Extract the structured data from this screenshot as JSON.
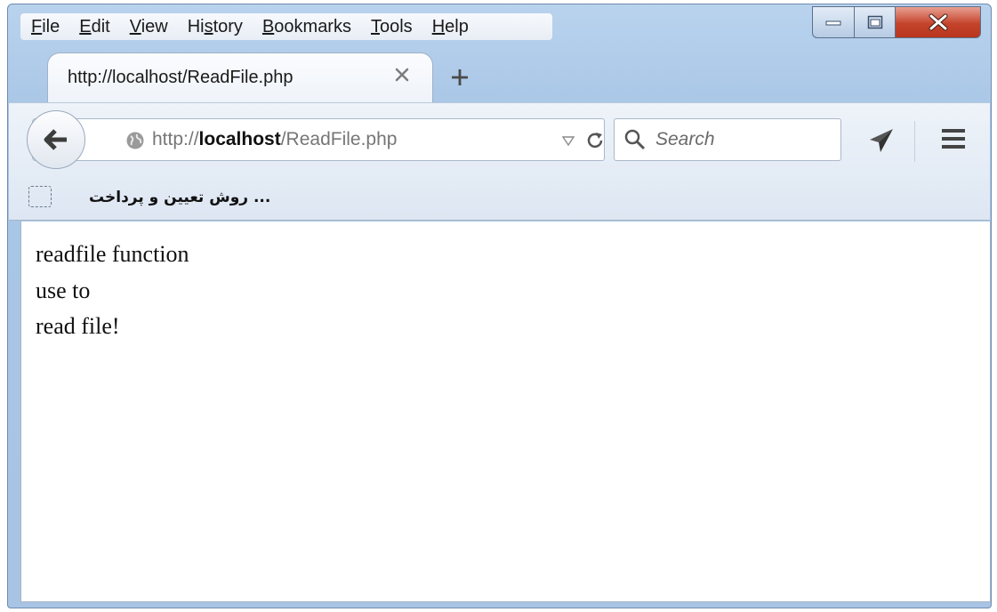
{
  "menubar": {
    "items": [
      {
        "pre": "",
        "ul": "F",
        "post": "ile"
      },
      {
        "pre": "",
        "ul": "E",
        "post": "dit"
      },
      {
        "pre": "",
        "ul": "V",
        "post": "iew"
      },
      {
        "pre": "Hi",
        "ul": "s",
        "post": "tory"
      },
      {
        "pre": "",
        "ul": "B",
        "post": "ookmarks"
      },
      {
        "pre": "",
        "ul": "T",
        "post": "ools"
      },
      {
        "pre": "",
        "ul": "H",
        "post": "elp"
      }
    ]
  },
  "tab": {
    "title": "http://localhost/ReadFile.php"
  },
  "urlbar": {
    "prefix": "http://",
    "host": "localhost",
    "path": "/ReadFile.php"
  },
  "search": {
    "placeholder": "Search"
  },
  "bookmarks": {
    "item_label": "... روش تعیین و پرداخت"
  },
  "page": {
    "lines": [
      "readfile function",
      "use to",
      "read file!"
    ]
  },
  "colors": {
    "close_button": "#c4432b",
    "frame": "#a9c6e6"
  }
}
